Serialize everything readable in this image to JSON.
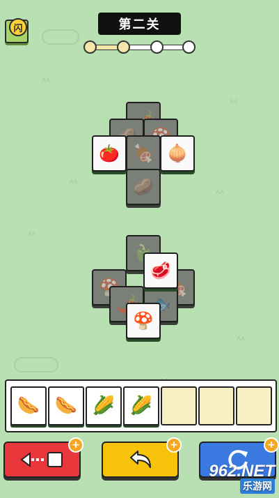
{
  "header": {
    "level_title": "第二关",
    "menu_badge": "闪"
  },
  "progress": {
    "current_stage": 2,
    "total_stages": 4
  },
  "tiles": {
    "group_top": [
      {
        "icon": "chili-icon",
        "glyph": "🌶️",
        "covered": true
      },
      {
        "icon": "potato-icon",
        "glyph": "🥔",
        "covered": true
      },
      {
        "icon": "mushroom-icon",
        "glyph": "🍄",
        "covered": true
      },
      {
        "icon": "meat-icon",
        "glyph": "🍖",
        "covered": true
      },
      {
        "icon": "potato-icon",
        "glyph": "🥔",
        "covered": true
      },
      {
        "icon": "tomato-icon",
        "glyph": "🍅",
        "covered": false
      },
      {
        "icon": "onion-icon",
        "glyph": "🧅",
        "covered": false
      }
    ],
    "group_bottom": [
      {
        "icon": "pepper-icon",
        "glyph": "🫑",
        "covered": true
      },
      {
        "icon": "mushroom-icon",
        "glyph": "🍄",
        "covered": true
      },
      {
        "icon": "chili-icon",
        "glyph": "🌶️",
        "covered": true
      },
      {
        "icon": "meat-icon",
        "glyph": "🍖",
        "covered": true
      },
      {
        "icon": "fish-icon",
        "glyph": "🐟",
        "covered": true
      },
      {
        "icon": "steak-icon",
        "glyph": "🥩",
        "covered": false
      },
      {
        "icon": "enoki-icon",
        "glyph": "🍄",
        "covered": false
      }
    ]
  },
  "tray": {
    "slots": [
      {
        "icon": "sausage-icon",
        "glyph": "🌭"
      },
      {
        "icon": "sausage-icon",
        "glyph": "🌭"
      },
      {
        "icon": "bamboo-shoot-icon",
        "glyph": "🌽"
      },
      {
        "icon": "bamboo-shoot-icon",
        "glyph": "🌽"
      },
      null,
      null,
      null
    ]
  },
  "buttons": {
    "move_out": {
      "color": "#e8383b"
    },
    "undo": {
      "color": "#f7c20a"
    },
    "shuffle": {
      "color": "#3a7ae0"
    }
  },
  "watermark": {
    "number": "962.NET",
    "site": "乐游网"
  }
}
